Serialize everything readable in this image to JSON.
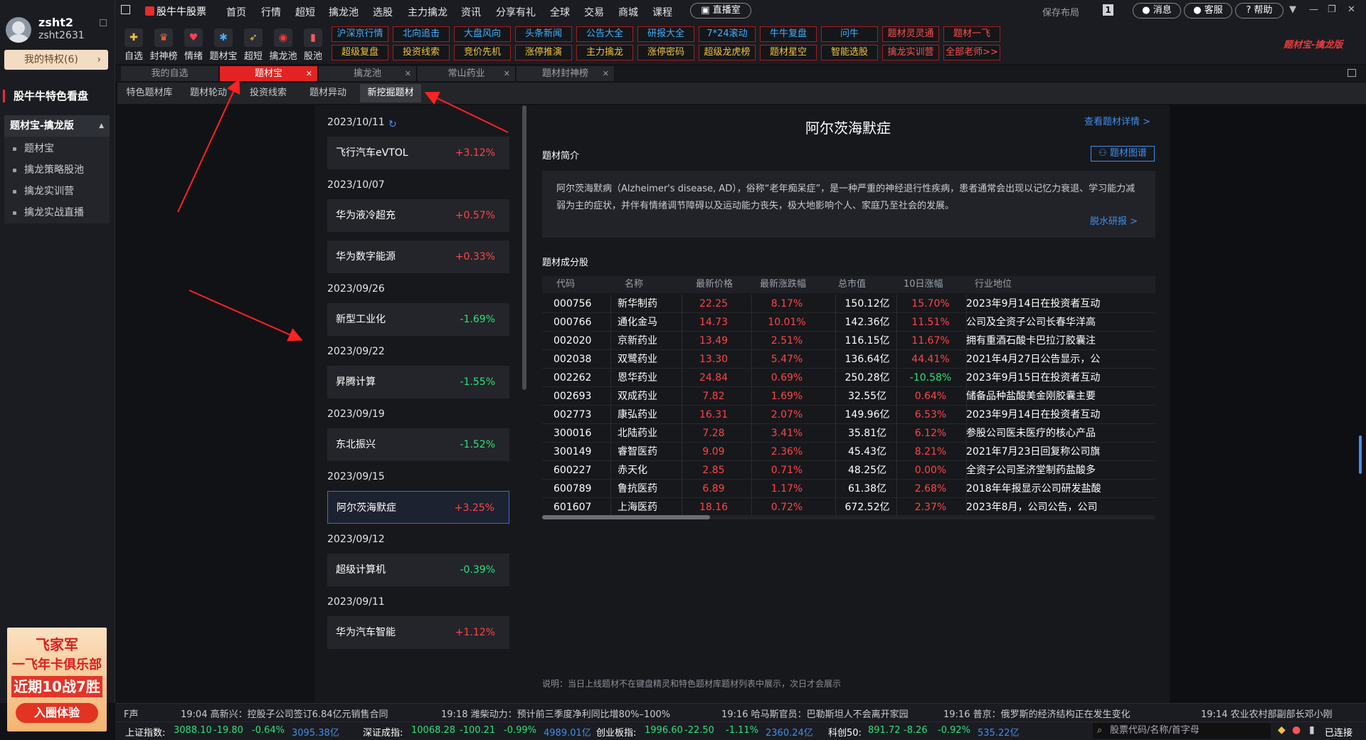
{
  "user": {
    "name": "zsht2",
    "id": "zsht2631",
    "privilege": "我的特权(6)"
  },
  "sidebar": {
    "section_title": "股牛牛特色看盘",
    "group_title": "题材宝-擒龙版",
    "items": [
      "题材宝",
      "擒龙策略股池",
      "擒龙实训营",
      "擒龙实战直播"
    ]
  },
  "ad": {
    "line1": "飞家军",
    "line2": "一飞年卡俱乐部",
    "line3": "近期10战7胜",
    "button": "入圈体验"
  },
  "topbar": {
    "brand": "股牛牛股票",
    "nav": [
      "首页",
      "行情",
      "超短",
      "擒龙池",
      "选股",
      "主力擒龙",
      "资讯",
      "分享有礼",
      "全球",
      "交易",
      "商城",
      "课程"
    ],
    "live": "直播室",
    "save_layout": "保存布局",
    "layout_num": "1",
    "messages": "消息",
    "service": "客服",
    "help": "帮助"
  },
  "toolbar": {
    "tools": [
      {
        "label": "自选",
        "icon": "plus-folder-icon"
      },
      {
        "label": "封神榜",
        "icon": "trophy-icon"
      },
      {
        "label": "情绪",
        "icon": "heart-icon"
      },
      {
        "label": "题材宝",
        "icon": "cluster-icon"
      },
      {
        "label": "超短",
        "icon": "rocket-icon"
      },
      {
        "label": "擒龙池",
        "icon": "target-icon"
      },
      {
        "label": "股池",
        "icon": "candlestick-icon"
      }
    ],
    "row1": [
      "沪深京行情",
      "北向追击",
      "大盘风向",
      "头条新闻",
      "公告大全",
      "研报大全",
      "7*24滚动",
      "牛牛复盘",
      "问牛",
      "题材灵灵通",
      "题材一飞"
    ],
    "row2": [
      "超级复盘",
      "投资线索",
      "竞价先机",
      "涨停推演",
      "主力擒龙",
      "涨停密码",
      "超级龙虎榜",
      "题材星空",
      "智能选股",
      "擒龙实训营",
      "全部老师>>"
    ],
    "badge": "题材宝-擒龙版"
  },
  "tabs": [
    "我的自选",
    "题材宝",
    "擒龙池",
    "常山药业",
    "题材封神榜"
  ],
  "subtabs": [
    "特色题材库",
    "题材轮动",
    "投资线索",
    "题材异动",
    "新挖掘题材"
  ],
  "timeline": [
    {
      "date": "2023/10/11",
      "items": [
        {
          "name": "飞行汽车eVTOL",
          "change": "+3.12%"
        }
      ]
    },
    {
      "date": "2023/10/07",
      "items": [
        {
          "name": "华为液冷超充",
          "change": "+0.57%"
        },
        {
          "name": "华为数字能源",
          "change": "+0.33%"
        }
      ]
    },
    {
      "date": "2023/09/26",
      "items": [
        {
          "name": "新型工业化",
          "change": "-1.69%"
        }
      ]
    },
    {
      "date": "2023/09/22",
      "items": [
        {
          "name": "昇腾计算",
          "change": "-1.55%"
        }
      ]
    },
    {
      "date": "2023/09/19",
      "items": [
        {
          "name": "东北振兴",
          "change": "-1.52%"
        }
      ]
    },
    {
      "date": "2023/09/15",
      "items": [
        {
          "name": "阿尔茨海默症",
          "change": "+3.25%"
        }
      ]
    },
    {
      "date": "2023/09/12",
      "items": [
        {
          "name": "超级计算机",
          "change": "-0.39%"
        }
      ]
    },
    {
      "date": "2023/09/11",
      "items": [
        {
          "name": "华为汽车智能",
          "change": "+1.12%"
        }
      ]
    }
  ],
  "detail": {
    "title": "阿尔茨海默症",
    "view_detail": "查看题材详情 >",
    "intro_label": "题材简介",
    "intro_map": "题材图谱",
    "intro_text": "阿尔茨海默病（Alzheimer's disease, AD），俗称“老年痴呆症”，是一种严重的神经退行性疾病，患者通常会出现以记忆力衰退、学习能力减弱为主的症状，并伴有情绪调节障碍以及运动能力丧失，极大地影响个人、家庭乃至社会的发展。",
    "intro_more": "脱水研报 >",
    "constituents_label": "题材成分股",
    "columns": [
      "代码",
      "名称",
      "最新价格",
      "最新涨跌幅",
      "总市值",
      "10日涨幅",
      "行业地位"
    ],
    "rows": [
      [
        "000756",
        "新华制药",
        "22.25",
        "8.17%",
        "150.12亿",
        "15.70%",
        "2023年9月14日在投资者互动"
      ],
      [
        "000766",
        "通化金马",
        "14.73",
        "10.01%",
        "142.36亿",
        "11.51%",
        "公司及全资子公司长春华洋高"
      ],
      [
        "002020",
        "京新药业",
        "13.49",
        "2.51%",
        "116.15亿",
        "11.67%",
        "拥有重酒石酸卡巴拉汀胶囊注"
      ],
      [
        "002038",
        "双鹭药业",
        "13.30",
        "5.47%",
        "136.64亿",
        "44.41%",
        "2021年4月27日公告显示，公"
      ],
      [
        "002262",
        "恩华药业",
        "24.84",
        "0.69%",
        "250.28亿",
        "-10.58%",
        "2023年9月15日在投资者互动"
      ],
      [
        "002693",
        "双成药业",
        "7.82",
        "1.69%",
        "32.55亿",
        "0.64%",
        "储备品种盐酸美金刚胶囊主要"
      ],
      [
        "002773",
        "康弘药业",
        "16.31",
        "2.07%",
        "149.96亿",
        "6.53%",
        "2023年9月14日在投资者互动"
      ],
      [
        "300016",
        "北陆药业",
        "7.28",
        "3.41%",
        "35.81亿",
        "6.12%",
        "参股公司医未医疗的核心产品"
      ],
      [
        "300149",
        "睿智医药",
        "9.09",
        "2.36%",
        "45.43亿",
        "8.21%",
        "2021年7月23日回复称公司旗"
      ],
      [
        "600227",
        "赤天化",
        "2.85",
        "0.71%",
        "48.25亿",
        "0.00%",
        "全资子公司圣济堂制药盐酸多"
      ],
      [
        "600789",
        "鲁抗医药",
        "6.89",
        "1.17%",
        "61.38亿",
        "2.68%",
        "2018年年报显示公司研发盐酸"
      ],
      [
        "601607",
        "上海医药",
        "18.16",
        "0.72%",
        "672.52亿",
        "2.37%",
        "2023年8月，公司公告，公司"
      ]
    ],
    "footnote": "说明：当日上线题材不在键盘精灵和特色题材库题材列表中展示，次日才会展示"
  },
  "ticker": {
    "label": "F声",
    "news": [
      "19:04 高新兴：控股子公司签订6.84亿元销售合同",
      "19:18 潍柴动力：预计前三季度净利同比增80%–100%",
      "19:16 哈马斯官员：巴勒斯坦人不会离开家园",
      "19:16 普京：俄罗斯的经济结构正在发生变化",
      "19:14 农业农村部副部长邓小刚"
    ]
  },
  "status": {
    "indices": [
      {
        "name": "上证指数:",
        "price": "3088.10",
        "chg": "-19.80",
        "pct": "-0.64%",
        "amt": "3095.38亿"
      },
      {
        "name": "深证成指:",
        "price": "10068.28",
        "chg": "-100.21",
        "pct": "-0.99%",
        "amt": "4989.01亿"
      },
      {
        "name": "创业板指:",
        "price": "1996.60",
        "chg": "-22.50",
        "pct": "-1.11%",
        "amt": "2360.24亿"
      },
      {
        "name": "科创50:",
        "price": "891.72",
        "chg": "-8.26",
        "pct": "-0.92%",
        "amt": "535.22亿"
      }
    ],
    "search_placeholder": "股票代码/名称/首字母",
    "connected": "已连接"
  },
  "colors": {
    "up": "#ff4545",
    "down": "#2fe07a",
    "accent": "#e32323",
    "link": "#3f8eea"
  }
}
